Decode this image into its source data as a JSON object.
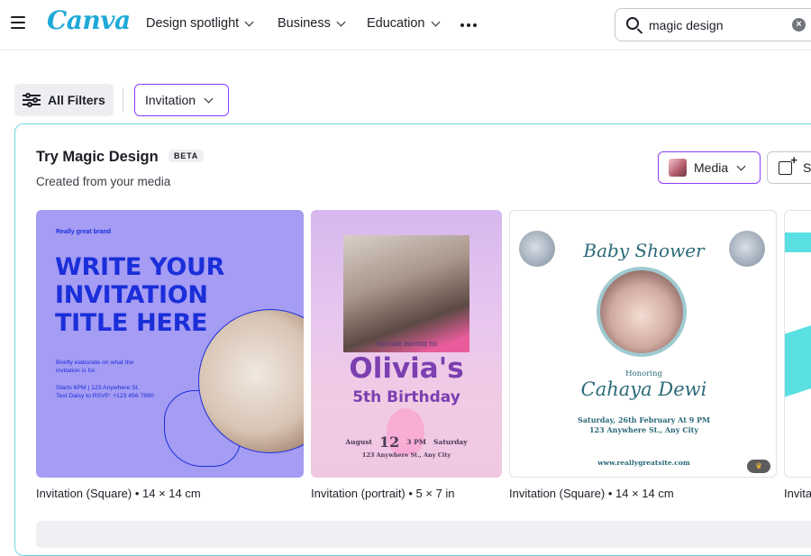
{
  "topbar": {
    "logo": "Canva",
    "nav": [
      {
        "label": "Design spotlight"
      },
      {
        "label": "Business"
      },
      {
        "label": "Education"
      }
    ],
    "search": {
      "value": "magic design"
    }
  },
  "filters": {
    "all_filters_label": "All Filters",
    "chip_label": "Invitation"
  },
  "magic": {
    "title": "Try Magic Design",
    "badge": "BETA",
    "subtitle": "Created from your media",
    "media_button": "Media",
    "second_button": "S"
  },
  "cards": [
    {
      "label": "Invitation (Square) • 14 × 14 cm",
      "brand": "Really great brand",
      "headline_lines": [
        "WRITE YOUR",
        "INVITATION",
        "TITLE HERE"
      ],
      "body": [
        "Briefly elaborate on what the",
        "invitation is for."
      ],
      "details": [
        "Starts 6PM | 123 Anywhere St.",
        "Text Daisy to RSVP: +123 456 7890"
      ]
    },
    {
      "label": "Invitation (portrait) • 5 × 7 in",
      "invited": "YOU ARE INVITED TO",
      "name": "Olivia's",
      "occasion": "5th Birthday",
      "month": "August",
      "day": "12",
      "time": "3 PM",
      "weekday": "Saturday",
      "address": "123 Anywhere St., Any City"
    },
    {
      "label": "Invitation (Square) • 14 × 14 cm",
      "title": "Baby Shower",
      "honoring": "Honoring",
      "name": "Cahaya Dewi",
      "date": "Saturday, 26th February At 9 PM",
      "address": "123 Anywhere St., Any City",
      "url": "www.reallygreatsite.com"
    },
    {
      "label": "Invita"
    }
  ],
  "colors": {
    "accent_purple": "#8b3dff",
    "panel_border": "#6fd8e0",
    "card1_bg": "#a59cf4",
    "card1_text": "#1a2fd9",
    "card3_text": "#2b6a78"
  }
}
